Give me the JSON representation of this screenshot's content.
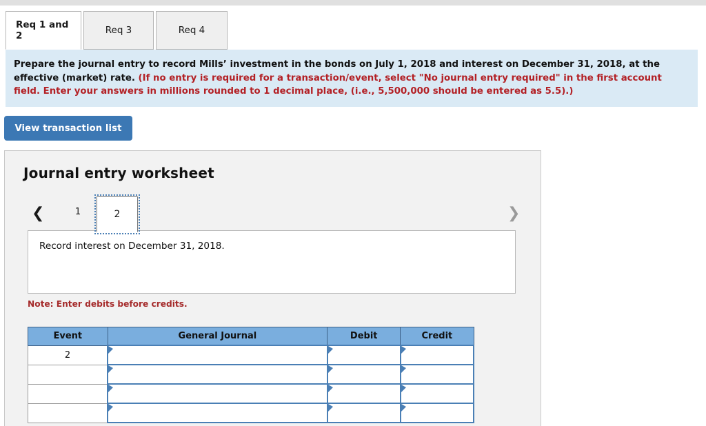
{
  "tabs": [
    {
      "label": "Req 1 and 2",
      "active": true
    },
    {
      "label": "Req 3",
      "active": false
    },
    {
      "label": "Req 4",
      "active": false
    }
  ],
  "instruction": {
    "black_text": "Prepare the journal entry to record Mills’ investment in the bonds on July 1, 2018 and interest on December 31, 2018, at the effective (market) rate.",
    "red_text": "(If no entry is required for a transaction/event, select \"No journal entry required\" in the first account field. Enter your answers in millions rounded to 1 decimal place, (i.e., 5,500,000 should be entered as 5.5).)"
  },
  "buttons": {
    "view_transaction_list": "View transaction list"
  },
  "worksheet": {
    "title": "Journal entry worksheet",
    "pager": {
      "prev_icon": "chevron-left",
      "next_icon": "chevron-right",
      "pages": [
        "1",
        "2"
      ],
      "active_page": "2"
    },
    "description": "Record interest on December 31, 2018.",
    "note": "Note: Enter debits before credits.",
    "table": {
      "headers": [
        "Event",
        "General Journal",
        "Debit",
        "Credit"
      ],
      "rows": [
        {
          "event": "2",
          "general_journal": "",
          "debit": "",
          "credit": ""
        },
        {
          "event": "",
          "general_journal": "",
          "debit": "",
          "credit": ""
        },
        {
          "event": "",
          "general_journal": "",
          "debit": "",
          "credit": ""
        },
        {
          "event": "",
          "general_journal": "",
          "debit": "",
          "credit": ""
        }
      ]
    }
  },
  "colors": {
    "accent_blue": "#3c78b4",
    "table_header_blue": "#7aaede",
    "info_panel_blue": "#daeaf5",
    "red_text": "#b32025",
    "note_red": "#a52a2a"
  }
}
